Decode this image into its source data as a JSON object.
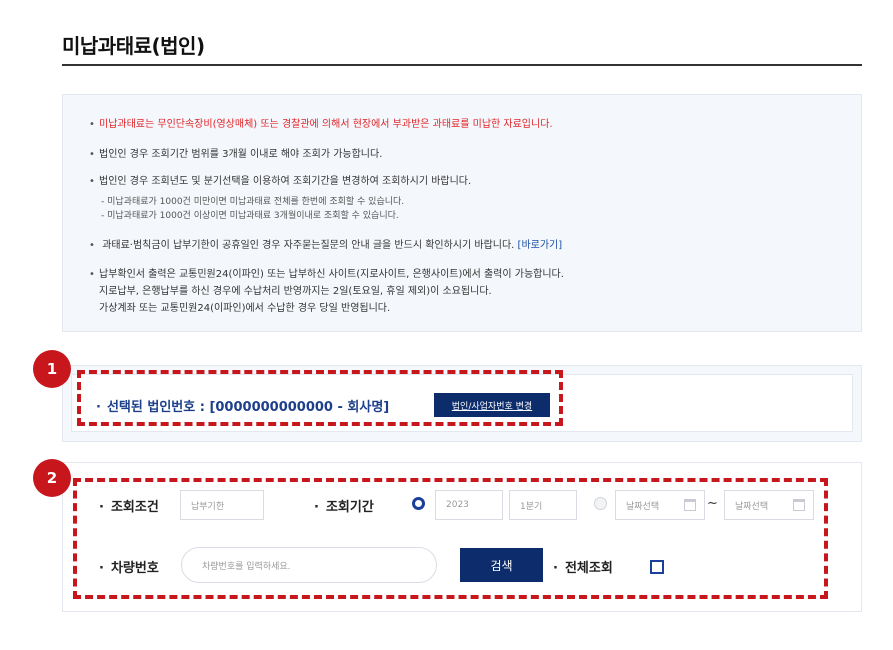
{
  "page": {
    "title": "미납과태료(법인)"
  },
  "notice": {
    "line1": "미납과태료는 무인단속장비(영상매체) 또는 경찰관에 의해서 현장에서 부과받은 과태료를 미납한 자료입니다.",
    "line2": "법인인 경우 조회기간 범위를 3개월 이내로 해야 조회가 가능합니다.",
    "line3": "법인인 경우 조회년도 및 분기선택을 이용하여 조회기간을 변경하여 조회하시기 바랍니다.",
    "line3_sub1": "- 미납과태료가 1000건 미만이면 미납과태료 전체를 한번에 조회할 수 있습니다.",
    "line3_sub2": "- 미납과태료가 1000건 이상이면 미납과태료 3개월이내로 조회할 수 있습니다.",
    "line4": "과태료·범칙금이 납부기한이 공휴일인 경우 자주묻는질문의 안내 글을 반드시 확인하시기 바랍니다.",
    "line4_link": "[바로가기]",
    "line5a": "납부확인서 출력은 교통민원24(이파인) 또는 납부하신 사이트(지로사이트, 은행사이트)에서 출력이 가능합니다.",
    "line5b": "지로납부, 은행납부를 하신 경우에 수납처리 반영까지는 2일(토요일, 휴일 제외)이 소요됩니다.",
    "line5c": "가상계좌 또는 교통민원24(이파인)에서 수납한 경우 당일 반영됩니다."
  },
  "badges": {
    "one": "1",
    "two": "2"
  },
  "corp": {
    "selected_label": "선택된 법인번호 : [0000000000000 - 회사명]",
    "change_button": "법인/사업자번호 변경"
  },
  "search": {
    "condition_label": "조회조건",
    "condition_value": "납부기한",
    "period_label": "조회기간",
    "year": "2023",
    "quarter": "1분기",
    "date_from_placeholder": "날짜선택",
    "date_sep": "~",
    "date_to_placeholder": "날짜선택",
    "plate_label": "차량번호",
    "plate_placeholder": "차량번호를 입력하세요.",
    "search_button": "검색",
    "all_label": "전체조회"
  },
  "colors": {
    "accent": "#0d2c6c",
    "highlight": "#c8171c",
    "notice_red": "#e0262b"
  }
}
